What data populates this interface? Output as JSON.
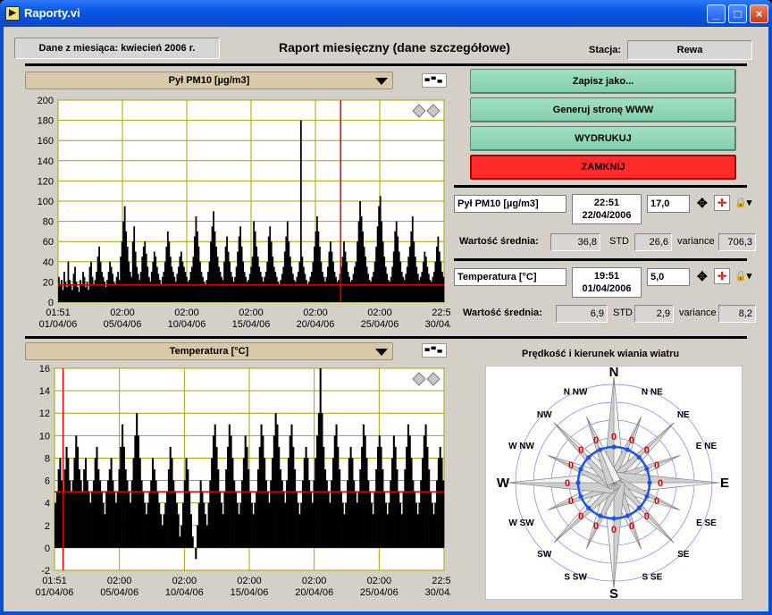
{
  "window": {
    "title": "Raporty.vi",
    "minimize": "_",
    "maximize": "□",
    "close": "×"
  },
  "header": {
    "month_label": "Dane z miesiąca: kwiecień 2006 r.",
    "report_title": "Raport miesięczny (dane szczegółowe)",
    "station_label": "Stacja:",
    "station_value": "Rewa"
  },
  "buttons": {
    "save_as": "Zapisz jako...",
    "generate_www": "Generuj stronę WWW",
    "print": "WYDRUKUJ",
    "close": "ZAMKNIJ"
  },
  "cursor1": {
    "name": "Pył PM10 [µg/m3]",
    "time": "22:51",
    "date": "22/04/2006",
    "value": "17,0",
    "mean_label": "Wartość średnia:",
    "mean": "36,8",
    "std_label": "STD",
    "std": "26,6",
    "var_label": "variance",
    "variance": "706,3"
  },
  "cursor2": {
    "name": "Temperatura [°C]",
    "time": "19:51",
    "date": "01/04/2006",
    "value": "5,0",
    "mean_label": "Wartość średnia:",
    "mean": "6,9",
    "std_label": "STD",
    "std": "2,9",
    "var_label": "variance",
    "variance": "8,2"
  },
  "wind_rose": {
    "title": "Prędkość i kierunek wiania wiatru",
    "directions": [
      "N",
      "N NE",
      "NE",
      "E NE",
      "E",
      "E SE",
      "SE",
      "S SE",
      "S",
      "S SW",
      "SW",
      "W SW",
      "W",
      "W NW",
      "NW",
      "N NW"
    ],
    "values": [
      "0",
      "0",
      "0",
      "0",
      "0",
      "0",
      "0",
      "0",
      "0",
      "0",
      "0",
      "0",
      "0",
      "0",
      "0",
      "0"
    ]
  },
  "chart_data": [
    {
      "type": "bar",
      "selector": "Pył PM10 [µg/m3]",
      "ylim": [
        0,
        200
      ],
      "y_ticks": [
        "0",
        "20",
        "40",
        "60",
        "80",
        "100",
        "120",
        "140",
        "160",
        "180",
        "200"
      ],
      "x_ticks": [
        {
          "time": "01:51",
          "date": "01/04/06"
        },
        {
          "time": "02:00",
          "date": "05/04/06"
        },
        {
          "time": "02:00",
          "date": "10/04/06"
        },
        {
          "time": "02:00",
          "date": "15/04/06"
        },
        {
          "time": "02:00",
          "date": "20/04/06"
        },
        {
          "time": "02:00",
          "date": "25/04/06"
        },
        {
          "time": "22:51",
          "date": "30/04/06"
        }
      ],
      "cursor_y": 17,
      "cursor_x_date": "22/04/2006 22:51",
      "values": [
        25,
        18,
        22,
        12,
        30,
        20,
        15,
        40,
        22,
        18,
        12,
        28,
        35,
        20,
        15,
        10,
        22,
        18,
        30,
        25,
        15,
        20,
        12,
        35,
        40,
        25,
        18,
        22,
        30,
        45,
        55,
        40,
        30,
        25,
        20,
        15,
        22,
        30,
        40,
        35,
        28,
        20,
        18,
        25,
        30,
        22,
        45,
        60,
        80,
        95,
        70,
        55,
        40,
        30,
        25,
        60,
        75,
        50,
        35,
        28,
        22,
        30,
        45,
        55,
        60,
        48,
        35,
        25,
        20,
        30,
        40,
        50,
        45,
        35,
        28,
        22,
        18,
        25,
        30,
        40,
        55,
        70,
        60,
        45,
        35,
        30,
        25,
        20,
        28,
        35,
        45,
        50,
        40,
        35,
        30,
        25,
        20,
        22,
        30,
        35,
        45,
        65,
        85,
        70,
        55,
        40,
        30,
        25,
        20,
        18,
        22,
        30,
        40,
        60,
        75,
        90,
        70,
        55,
        45,
        35,
        30,
        25,
        22,
        40,
        55,
        65,
        50,
        40,
        30,
        25,
        20,
        25,
        35,
        50,
        65,
        75,
        55,
        40,
        30,
        25,
        20,
        22,
        28,
        35,
        45,
        80,
        70,
        55,
        45,
        35,
        30,
        25,
        20,
        25,
        30,
        40,
        65,
        75,
        60,
        45,
        35,
        30,
        25,
        20,
        18,
        22,
        28,
        35,
        50,
        65,
        80,
        60,
        45,
        35,
        28,
        22,
        20,
        25,
        30,
        40,
        180,
        45,
        35,
        28,
        22,
        18,
        20,
        25,
        30,
        40,
        55,
        70,
        85,
        70,
        55,
        40,
        30,
        25,
        20,
        25,
        35,
        50,
        60,
        50,
        40,
        30,
        25,
        20,
        22,
        28,
        35,
        45,
        60,
        50,
        40,
        30,
        25,
        20,
        22,
        28,
        35,
        40,
        60,
        80,
        100,
        85,
        70,
        55,
        45,
        35,
        28,
        22,
        20,
        25,
        30,
        40,
        55,
        75,
        95,
        105,
        80,
        60,
        45,
        35,
        28,
        22,
        20,
        25,
        35,
        50,
        70,
        80,
        65,
        50,
        40,
        30,
        25,
        22,
        28,
        35,
        45,
        55,
        70,
        85,
        60,
        45,
        35,
        28,
        22,
        25,
        30,
        40,
        50,
        45,
        35,
        28,
        22,
        20,
        25,
        30,
        40,
        55,
        65,
        50,
        40,
        30,
        25
      ]
    },
    {
      "type": "bar",
      "selector": "Temperatura [°C]",
      "ylim": [
        -2,
        16
      ],
      "y_ticks": [
        "-2",
        "0",
        "2",
        "4",
        "6",
        "8",
        "10",
        "12",
        "14",
        "16"
      ],
      "x_ticks": [
        {
          "time": "01:51",
          "date": "01/04/06"
        },
        {
          "time": "02:00",
          "date": "05/04/06"
        },
        {
          "time": "02:00",
          "date": "10/04/06"
        },
        {
          "time": "02:00",
          "date": "15/04/06"
        },
        {
          "time": "02:00",
          "date": "20/04/06"
        },
        {
          "time": "02:00",
          "date": "25/04/06"
        },
        {
          "time": "22:51",
          "date": "30/04/06"
        }
      ],
      "cursor_y": 5,
      "cursor_x_date": "01/04/2006 19:51",
      "values": [
        4,
        5,
        7,
        8,
        6,
        5,
        7,
        9,
        8,
        6,
        5,
        6,
        8,
        10,
        9,
        7,
        6,
        5,
        7,
        8,
        6,
        5,
        4,
        5,
        6,
        8,
        9,
        7,
        6,
        5,
        4,
        3,
        5,
        6,
        7,
        8,
        6,
        5,
        4,
        5,
        7,
        9,
        11,
        9,
        7,
        6,
        5,
        4,
        6,
        8,
        10,
        12,
        10,
        8,
        6,
        5,
        4,
        3,
        4,
        5,
        6,
        8,
        7,
        6,
        5,
        4,
        3,
        2,
        3,
        4,
        5,
        7,
        9,
        8,
        6,
        5,
        4,
        3,
        1,
        2,
        4,
        6,
        8,
        7,
        5,
        3,
        1,
        0,
        -1,
        2,
        4,
        6,
        5,
        4,
        3,
        2,
        4,
        6,
        8,
        10,
        11,
        9,
        7,
        5,
        4,
        3,
        5,
        7,
        9,
        11,
        10,
        8,
        6,
        5,
        4,
        3,
        4,
        6,
        8,
        10,
        9,
        7,
        5,
        4,
        3,
        4,
        5,
        7,
        9,
        11,
        10,
        8,
        6,
        5,
        4,
        6,
        8,
        10,
        12,
        11,
        9,
        7,
        6,
        5,
        4,
        6,
        8,
        10,
        11,
        9,
        7,
        5,
        4,
        3,
        4,
        6,
        8,
        9,
        8,
        6,
        5,
        4,
        6,
        8,
        10,
        12,
        16,
        12,
        9,
        7,
        6,
        5,
        4,
        6,
        8,
        10,
        11,
        9,
        7,
        5,
        4,
        3,
        4,
        6,
        8,
        9,
        8,
        6,
        5,
        4,
        5,
        7,
        9,
        11,
        10,
        8,
        6,
        5,
        4,
        3,
        5,
        7,
        9,
        10,
        9,
        7,
        5,
        4,
        3,
        4,
        6,
        8,
        10,
        9,
        7,
        5,
        4,
        3,
        5,
        7,
        9,
        11,
        10,
        8,
        6,
        5,
        4,
        3,
        4,
        6,
        8,
        10,
        11,
        9,
        7,
        5,
        4,
        3,
        4,
        6,
        8,
        9,
        8,
        6
      ]
    }
  ],
  "colors": {
    "grid": "#a6a600",
    "bars": "#000000",
    "cursor": "#e00000",
    "button_green": "#9fe0c0",
    "button_red": "#ff2a2a",
    "rose_ring": "#1a55e6",
    "rose_value": "#e00000"
  }
}
